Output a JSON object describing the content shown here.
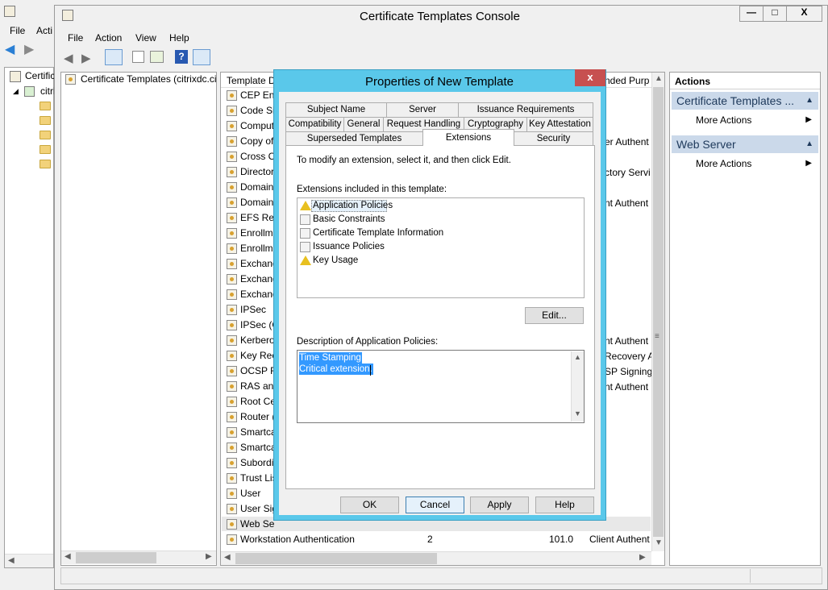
{
  "outer": {
    "tree_root": "Certific",
    "tree_child": "citri",
    "menu": [
      "File",
      "Acti"
    ]
  },
  "window": {
    "title": "Certificate Templates Console",
    "menu": [
      "File",
      "Action",
      "View",
      "Help"
    ],
    "controls": {
      "minimize": "—",
      "maximize": "□",
      "close": "X"
    }
  },
  "left_pane": {
    "root_label": "Certificate Templates (citrixdc.ci"
  },
  "list": {
    "columns": {
      "name": "Template D",
      "purpose": "nded Purp"
    },
    "items": [
      {
        "name": "CEP Enc",
        "purpose": ""
      },
      {
        "name": "Code Si",
        "purpose": ""
      },
      {
        "name": "Comput",
        "purpose": ""
      },
      {
        "name": "Copy of",
        "purpose": "er Authent"
      },
      {
        "name": "Cross C",
        "purpose": ""
      },
      {
        "name": "Director",
        "purpose": "ctory Servi"
      },
      {
        "name": "Domain",
        "purpose": ""
      },
      {
        "name": "Domain",
        "purpose": "nt Authent"
      },
      {
        "name": "EFS Rec",
        "purpose": ""
      },
      {
        "name": "Enrollm",
        "purpose": ""
      },
      {
        "name": "Enrollm",
        "purpose": ""
      },
      {
        "name": "Exchang",
        "purpose": ""
      },
      {
        "name": "Exchang",
        "purpose": ""
      },
      {
        "name": "Exchang",
        "purpose": ""
      },
      {
        "name": "IPSec",
        "purpose": ""
      },
      {
        "name": "IPSec (O",
        "purpose": ""
      },
      {
        "name": "Kerbero",
        "purpose": "nt Authent"
      },
      {
        "name": "Key Rec",
        "purpose": "Recovery A"
      },
      {
        "name": "OCSP Re",
        "purpose": "SP Signing"
      },
      {
        "name": "RAS and",
        "purpose": "nt Authent"
      },
      {
        "name": "Root Ce",
        "purpose": ""
      },
      {
        "name": "Router (",
        "purpose": ""
      },
      {
        "name": "Smartca",
        "purpose": ""
      },
      {
        "name": "Smartca",
        "purpose": ""
      },
      {
        "name": "Subordi",
        "purpose": ""
      },
      {
        "name": "Trust Lis",
        "purpose": ""
      },
      {
        "name": "User",
        "purpose": ""
      },
      {
        "name": "User Sig",
        "purpose": ""
      },
      {
        "name": "Web Serv",
        "purpose": ""
      }
    ],
    "last_row": {
      "name": "Workstation Authentication",
      "version": "2",
      "minor": "101.0",
      "purpose": "Client Authent"
    }
  },
  "actions": {
    "title": "Actions",
    "sections": [
      {
        "header": "Certificate Templates ...",
        "item": "More Actions"
      },
      {
        "header": "Web Server",
        "item": "More Actions"
      }
    ]
  },
  "dialog": {
    "title": "Properties of New Template",
    "close": "x",
    "tabs_row1": [
      "Subject Name",
      "Server",
      "Issuance Requirements"
    ],
    "tabs_row2": [
      "Compatibility",
      "General",
      "Request Handling",
      "Cryptography",
      "Key Attestation"
    ],
    "tabs_row3": [
      "Superseded Templates",
      "Extensions",
      "Security"
    ],
    "instruction": "To modify an extension, select it, and then click Edit.",
    "extensions_label": "Extensions included in this template:",
    "extensions": [
      {
        "name": "Application Policies",
        "icon": "warning-icon"
      },
      {
        "name": "Basic Constraints",
        "icon": "extension-icon"
      },
      {
        "name": "Certificate Template Information",
        "icon": "extension-icon"
      },
      {
        "name": "Issuance Policies",
        "icon": "extension-icon"
      },
      {
        "name": "Key Usage",
        "icon": "warning-icon"
      }
    ],
    "edit_button": "Edit...",
    "description_label": "Description of Application Policies:",
    "description_lines": [
      "Time Stamping",
      "Critical extension."
    ],
    "buttons": {
      "ok": "OK",
      "cancel": "Cancel",
      "apply": "Apply",
      "help": "Help"
    }
  },
  "colors": {
    "dialog_frame": "#5ac8ea",
    "selection": "#3399ff",
    "close_red": "#c75050"
  }
}
